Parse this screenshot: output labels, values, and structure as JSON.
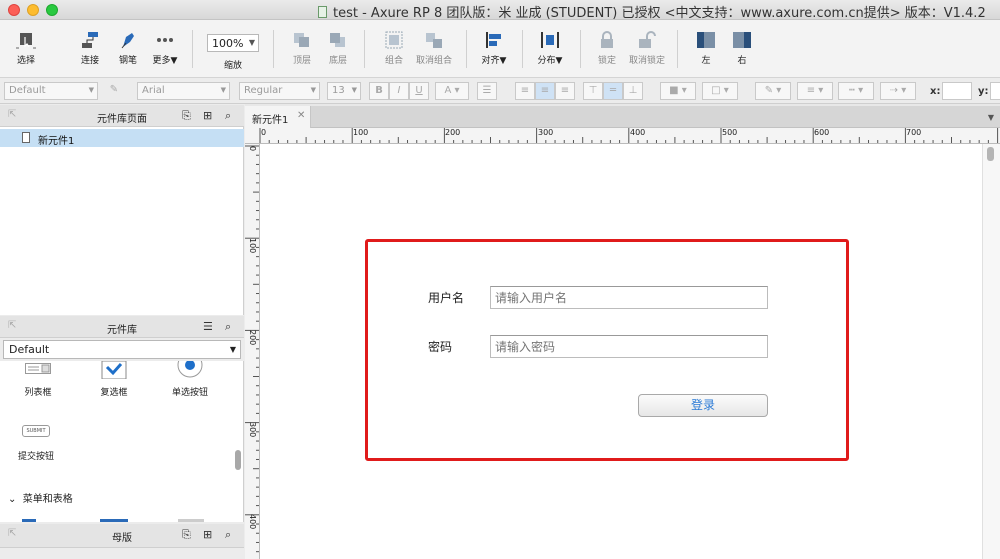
{
  "window": {
    "title": "test - Axure RP 8 团队版：米 业成 (STUDENT) 已授权      <中文支持：www.axure.com.cn提供> 版本：V1.4.2"
  },
  "toolbar": {
    "select": "选择",
    "connect": "连接",
    "pen": "钢笔",
    "more": "更多▼",
    "zoom_value": "100%",
    "zoom_label": "缩放",
    "top": "顶层",
    "bottom": "底层",
    "group": "组合",
    "ungroup": "取消组合",
    "align": "对齐▼",
    "distribute": "分布▼",
    "lock": "锁定",
    "unlock": "取消锁定",
    "left": "左",
    "right": "右"
  },
  "format": {
    "style": "Default",
    "font": "Arial",
    "weight": "Regular",
    "size": "13",
    "bold": "B",
    "italic": "I",
    "underline": "U",
    "text_color": "A",
    "x_label": "x:",
    "y_label": "y:"
  },
  "pages_panel": {
    "title": "元件库页面",
    "pages": [
      "新元件1"
    ]
  },
  "library_panel": {
    "title": "元件库",
    "selected": "Default",
    "widgets": [
      "列表框",
      "复选框",
      "单选按钮",
      "提交按钮"
    ],
    "submit_icon_text": "SUBMIT",
    "category": "菜单和表格"
  },
  "masters_panel": {
    "title": "母版"
  },
  "tabs": [
    "新元件1"
  ],
  "ruler": {
    "h_ticks": [
      "0",
      "100",
      "200",
      "300",
      "400",
      "500",
      "600",
      "700"
    ],
    "v_ticks": [
      "0",
      "100",
      "200",
      "300",
      "400"
    ]
  },
  "form": {
    "username_label": "用户名",
    "username_placeholder": "请输入用户名",
    "password_label": "密码",
    "password_placeholder": "请输入密码",
    "login_button": "登录"
  },
  "colors": {
    "highlight": "#e01b1b",
    "selected_row": "#c5dff4",
    "login_text": "#2a7ad6"
  }
}
